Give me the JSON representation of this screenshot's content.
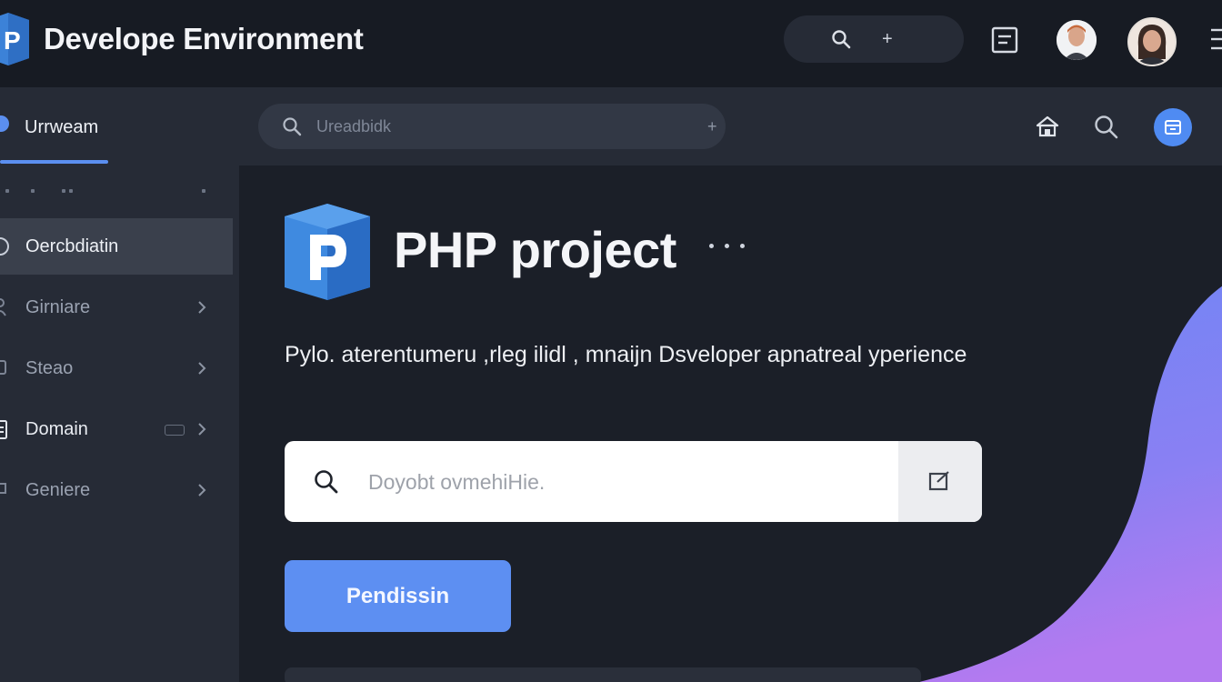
{
  "app": {
    "title": "Develope Environment"
  },
  "topbar": {
    "add_symbol": "+"
  },
  "sidebar": {
    "header": "Urrweam",
    "items": [
      {
        "label": "Oercbdiatin",
        "active": true
      },
      {
        "label": "Girniare",
        "active": false
      },
      {
        "label": "Steao",
        "active": false
      },
      {
        "label": "Domain",
        "active": false
      },
      {
        "label": "Geniere",
        "active": false
      }
    ]
  },
  "subbar": {
    "search_placeholder": "Ureadbidk",
    "add_symbol": "+"
  },
  "main": {
    "project_title": "PHP project",
    "description": "Pylo. aterentumeru ,rleg ilidl , mnaijn Dsveloper apnatreal yperience",
    "search_placeholder": "Doyobt ovmehiHie.",
    "primary_button": "Pendissin"
  },
  "colors": {
    "accent": "#5d8ff2",
    "background": "#1b1f28",
    "panel": "#262b36",
    "blob_gradient": [
      "#6f86f4",
      "#b37af0"
    ]
  },
  "icons": [
    "app-logo",
    "search-icon",
    "plus-icon",
    "document-icon",
    "menu-icon",
    "home-icon",
    "calendar-icon",
    "php-logo",
    "edit-icon",
    "chevron-right-icon"
  ]
}
